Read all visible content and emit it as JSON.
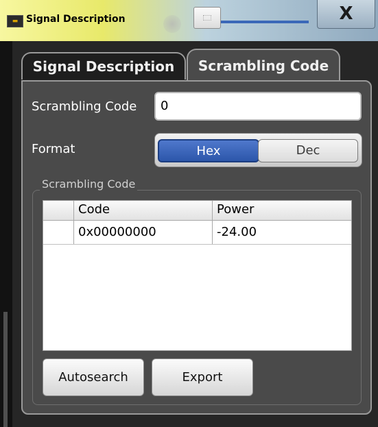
{
  "window": {
    "title": "Signal Description",
    "title_icon_glyph": "▬",
    "close_glyph": "X"
  },
  "tabs": [
    {
      "label": "Signal Description",
      "active": false
    },
    {
      "label": "Scrambling Code",
      "active": true
    }
  ],
  "form": {
    "scrambling_code_label": "Scrambling Code",
    "scrambling_code_value": "0",
    "format_label": "Format",
    "format_options": [
      "Hex",
      "Dec"
    ],
    "format_selected": "Hex"
  },
  "group": {
    "label": "Scrambling Code",
    "table": {
      "headers": [
        "",
        "Code",
        "Power"
      ],
      "rows": [
        {
          "marker": "",
          "code": "0x00000000",
          "power": "-24.00"
        }
      ]
    }
  },
  "buttons": {
    "autosearch": "Autosearch",
    "export": "Export"
  },
  "colors": {
    "titlebar_start": "#f7f7a0",
    "titlebar_end": "#8fa9be",
    "panel_bg": "#4a4a4a",
    "selected_toggle": "#2c56aa",
    "slider_track": "#3b68b8"
  },
  "icons": {
    "title_icon": "app-icon",
    "close": "close-icon"
  }
}
